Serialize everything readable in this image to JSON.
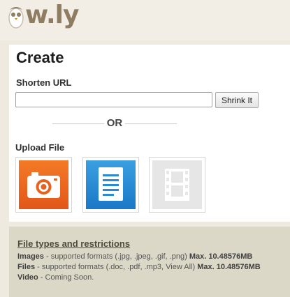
{
  "logo": {
    "text": "w.ly",
    "icon": "owl-icon"
  },
  "create": {
    "title": "Create",
    "shorten_label": "Shorten URL",
    "url_value": "",
    "url_placeholder": "",
    "shrink_label": "Shrink It",
    "or_text": "OR",
    "upload_label": "Upload File",
    "tiles": [
      {
        "icon": "camera-icon",
        "color": "#ef6a21"
      },
      {
        "icon": "document-icon",
        "color": "#2a8ad4"
      },
      {
        "icon": "film-icon",
        "color": "#e6e6e6"
      }
    ]
  },
  "restrictions": {
    "title": "File types and restrictions",
    "rows": [
      {
        "name": "Images",
        "text": " - supported formats (.jpg, .jpeg, .gif, .png) ",
        "limit": "Max. 10.48576MB"
      },
      {
        "name": "Files",
        "text": " - supported formats (.doc, .pdf, .mp3, View All) ",
        "limit": "Max. 10.48576MB"
      },
      {
        "name": "Video",
        "text": " - Coming Soon.",
        "limit": ""
      }
    ]
  }
}
